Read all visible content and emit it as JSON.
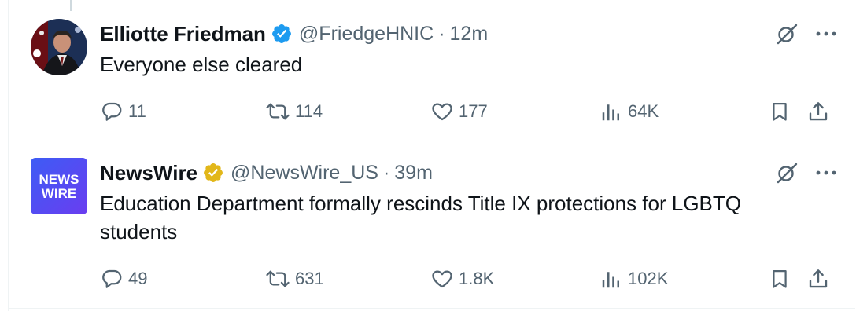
{
  "colors": {
    "verified_blue": "#1d9bf0",
    "verified_gold": "#e2b719",
    "muted": "#536471",
    "text": "#0f1419"
  },
  "tweets": [
    {
      "name": "Elliotte Friedman",
      "verified": "blue",
      "handle": "@FriedgeHNIC",
      "separator": "·",
      "time": "12m",
      "text": "Everyone else cleared",
      "replies": "11",
      "reposts": "114",
      "likes": "177",
      "views": "64K"
    },
    {
      "name": "NewsWire",
      "verified": "gold",
      "avatar_text_line1": "NEWS",
      "avatar_text_line2": "WIRE",
      "handle": "@NewsWire_US",
      "separator": "·",
      "time": "39m",
      "text": "Education Department formally rescinds Title IX protections for LGBTQ students",
      "replies": "49",
      "reposts": "631",
      "likes": "1.8K",
      "views": "102K"
    }
  ]
}
